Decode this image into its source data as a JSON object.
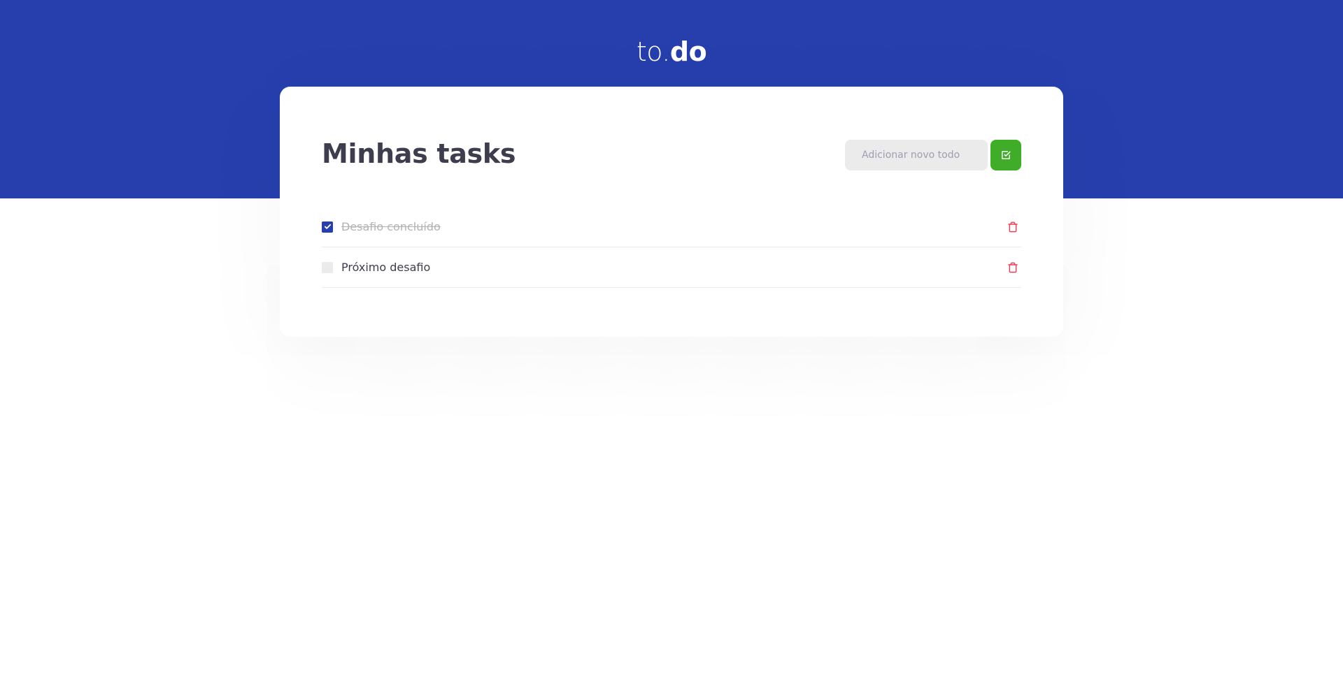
{
  "header": {
    "logo_light": "to.",
    "logo_bold": "do"
  },
  "main": {
    "title": "Minhas tasks",
    "add_input": {
      "placeholder": "Adicionar novo todo",
      "value": ""
    },
    "add_button_icon": "check-square-icon"
  },
  "tasks": [
    {
      "title": "Desafio concluído",
      "done": true,
      "delete_icon": "trash-icon"
    },
    {
      "title": "Próximo desafio",
      "done": false,
      "delete_icon": "trash-icon"
    }
  ],
  "colors": {
    "header_bg": "#273fad",
    "accent_green": "#3fad27",
    "delete_red": "#e83f5b",
    "text_dark": "#3d3d4d",
    "checkbox_checked": "#273fad",
    "input_bg": "#ebebeb"
  }
}
